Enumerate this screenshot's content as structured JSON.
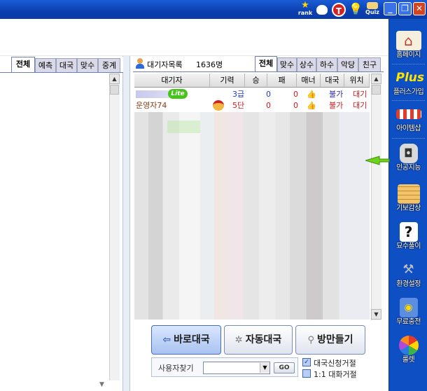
{
  "titlebar": {
    "rank_label": "rank",
    "quiz_label": "Quiz",
    "t_label": "T",
    "help_label": "?",
    "minimize": "_",
    "restore": "❐",
    "close": "✕"
  },
  "left_panel": {
    "tabs": [
      "전체",
      "예측",
      "대국",
      "맞수",
      "중계"
    ],
    "scroll_up": "▲",
    "scroll_down": "▼"
  },
  "wait_panel": {
    "title": "대기자목록",
    "count": "1636명",
    "tabs": [
      "전체",
      "맞수",
      "상수",
      "하수",
      "악당",
      "친구"
    ],
    "columns": [
      "대기자",
      "기력",
      "승",
      "패",
      "매너",
      "대국",
      "위치"
    ],
    "rows": [
      {
        "name": "",
        "badge": "Lite",
        "rank": "3급",
        "win": "0",
        "loss": "0",
        "manner": "👍",
        "game": "불가",
        "location": "대기"
      },
      {
        "name": "운영자74",
        "badge": "",
        "rank": "5단",
        "win": "0",
        "loss": "0",
        "manner": "👍",
        "game": "불가",
        "location": "대기"
      }
    ]
  },
  "buttons": {
    "direct_game": "바로대국",
    "auto_game": "자동대국",
    "make_room": "방만들기"
  },
  "search": {
    "label": "사용자찾기",
    "go": "GO"
  },
  "options": {
    "refuse_game": "대국신청거절",
    "refuse_chat": "1:1 대화거절"
  },
  "sidebar": {
    "items": [
      {
        "label": "홈페이지",
        "icon": "home-icon"
      },
      {
        "label": "플러스가입",
        "icon": "plus-icon"
      },
      {
        "label": "아이템샵",
        "icon": "shop-icon"
      },
      {
        "label": "인공지능",
        "icon": "robot-icon"
      },
      {
        "label": "기보감상",
        "icon": "board-icon"
      },
      {
        "label": "묘수풀이",
        "icon": "question-icon"
      },
      {
        "label": "환경설정",
        "icon": "tools-icon"
      },
      {
        "label": "무료충전",
        "icon": "safe-icon"
      },
      {
        "label": "룰렛",
        "icon": "roulette-icon"
      }
    ],
    "plus_text": "Plus"
  },
  "colors": {
    "sidebar": "#0f4fc4",
    "titlebar": "#0b3fb0",
    "accent_blue": "#1f3cc8",
    "red_text": "#d21b1b"
  }
}
